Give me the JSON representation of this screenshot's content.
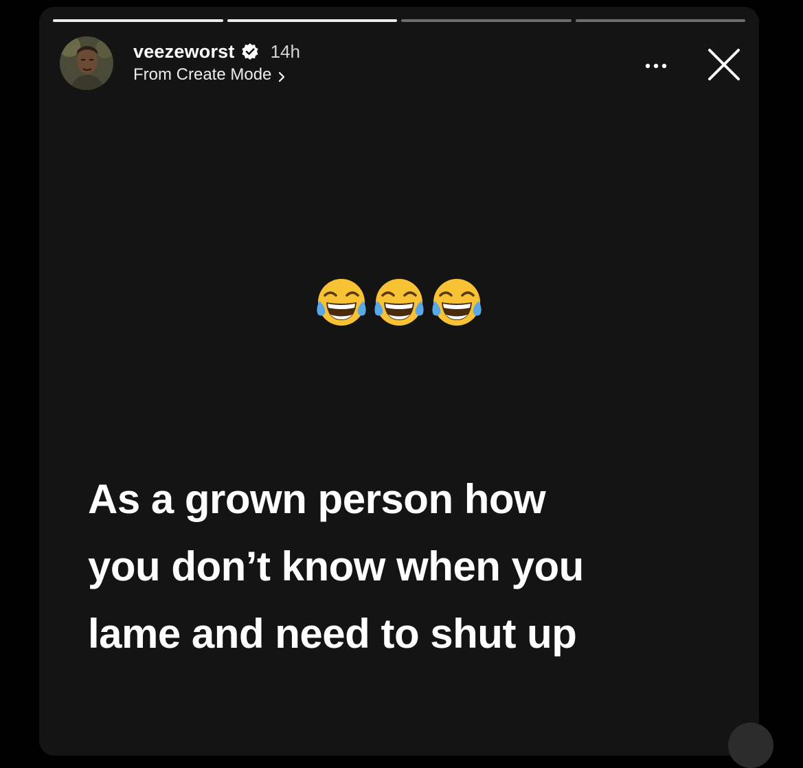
{
  "story": {
    "progress": {
      "segments_total": 4,
      "segments_completed": 2
    },
    "user": {
      "username": "veezeworst",
      "verified": true,
      "time_ago": "14h",
      "source_label": "From Create Mode"
    },
    "emoji_name": "face-with-tears-of-joy",
    "emoji_count": 3,
    "text": "As a grown person how\nyou don’t know when you\nlame and need to shut up"
  },
  "icons": {
    "more": "more-horizontal-icon",
    "close": "close-icon",
    "verified": "verified-badge-icon",
    "chevron": "chevron-right-icon"
  },
  "colors": {
    "background": "#141414",
    "text": "#ffffff",
    "emoji_face": "#f7c233"
  }
}
